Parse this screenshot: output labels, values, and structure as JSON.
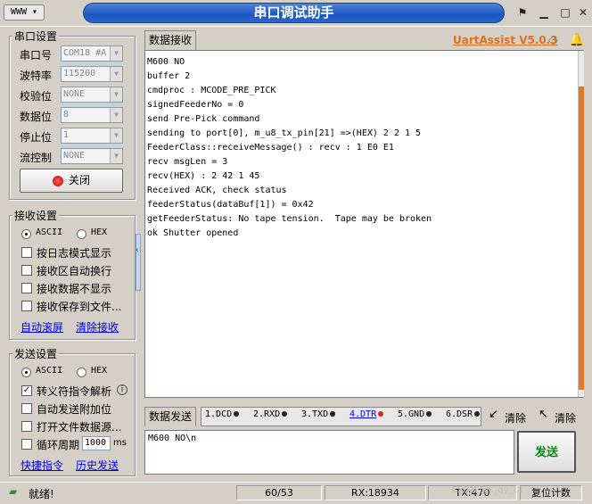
{
  "window": {
    "title": "串口调试助手",
    "menu_icon": "WWW",
    "brand": "UartAssist V5.0.3"
  },
  "serial_settings": {
    "title": "串口设置",
    "port_label": "串口号",
    "port_value": "COM18 #A",
    "baud_label": "波特率",
    "baud_value": "115200",
    "parity_label": "校验位",
    "parity_value": "NONE",
    "databits_label": "数据位",
    "databits_value": "8",
    "stopbits_label": "停止位",
    "stopbits_value": "1",
    "flow_label": "流控制",
    "flow_value": "NONE",
    "close_button": "关闭"
  },
  "receive_settings": {
    "title": "接收设置",
    "ascii": "ASCII",
    "hex": "HEX",
    "selected": "ASCII",
    "options": [
      {
        "label": "按日志模式显示",
        "checked": false
      },
      {
        "label": "接收区自动换行",
        "checked": false
      },
      {
        "label": "接收数据不显示",
        "checked": false
      },
      {
        "label": "接收保存到文件...",
        "checked": false
      }
    ],
    "auto_scroll": "自动滚屏",
    "clear_receive": "清除接收"
  },
  "send_settings": {
    "title": "发送设置",
    "ascii": "ASCII",
    "hex": "HEX",
    "selected": "ASCII",
    "options": [
      {
        "label": "转义符指令解析",
        "checked": true
      },
      {
        "label": "自动发送附加位",
        "checked": false
      },
      {
        "label": "打开文件数据源...",
        "checked": false
      },
      {
        "label": "循环周期",
        "checked": false
      }
    ],
    "period_value": "1000",
    "period_unit": "ms",
    "quick_cmd": "快捷指令",
    "history": "历史发送"
  },
  "receive_tab": "数据接收",
  "receive_text": "M600 NO\nbuffer 2\ncmdproc : MCODE_PRE_PICK\nsignedFeederNo = 0\nsend Pre-Pick command\nsending to port[0], m_u8_tx_pin[21] =>(HEX) 2 2 1 5\nFeederClass::receiveMessage() : recv : 1 E0 E1\nrecv msgLen = 3\nrecv(HEX) : 2 42 1 45\nReceived ACK, check status\nfeederStatus(dataBuf[1]) = 0x42\ngetFeederStatus: No tape tension.  Tape may be broken\nok Shutter opened",
  "send_tab": "数据发送",
  "signals": [
    {
      "label": "1.DCD",
      "color": "#222222"
    },
    {
      "label": "2.RXD",
      "color": "#222222"
    },
    {
      "label": "3.TXD",
      "color": "#222222"
    },
    {
      "label": "4.DTR",
      "color": "#e02020"
    },
    {
      "label": "5.GND",
      "color": "#222222"
    },
    {
      "label": "6.DSR",
      "color": "#222222"
    }
  ],
  "clear_1": "清除",
  "clear_2": "清除",
  "send_text": "M600 NO\\n",
  "send_button": "发送",
  "status": {
    "ready": "就绪!",
    "ratio": "60/53",
    "rx": "RX:18934",
    "tx": "TX:470",
    "reset": "复位计数",
    "watermark": "CSDN @L_qy_L1"
  },
  "colors": {
    "title_bar": "#1c55c2",
    "brand": "#e0701a",
    "send_button_text": "#0a8a0a",
    "accent": "#e07a2a"
  }
}
